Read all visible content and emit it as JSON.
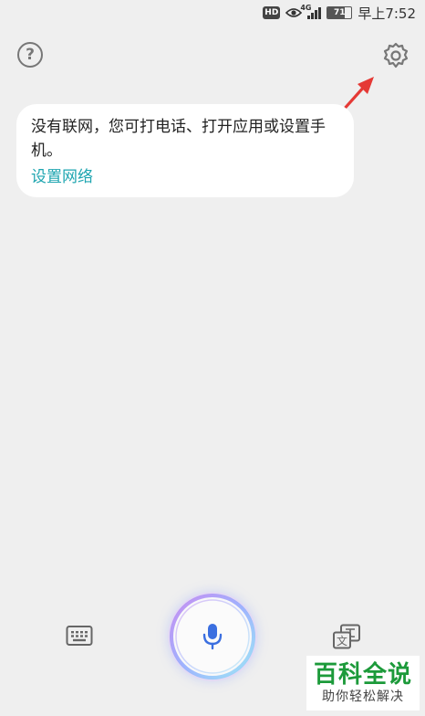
{
  "status_bar": {
    "hd_badge": "HD",
    "network": "4G",
    "battery": "71",
    "battery_level": 0.71,
    "time": "早上7:52"
  },
  "icons": {
    "help": "help-circle-icon",
    "settings": "gear-icon",
    "keyboard": "keyboard-icon",
    "mic": "microphone-icon",
    "translate": "translate-icon"
  },
  "help": {
    "glyph": "?"
  },
  "card": {
    "message": "没有联网，您可打电话、打开应用或设置手机。",
    "link": "设置网络"
  },
  "translate": {
    "glyph": "文"
  },
  "colors": {
    "link": "#1ea5b0",
    "mic": "#3b6fe0",
    "annotation": "#e53935",
    "watermark": "#1c9a3a"
  },
  "watermark": {
    "title": "百科全说",
    "subtitle": "助你轻松解决"
  }
}
